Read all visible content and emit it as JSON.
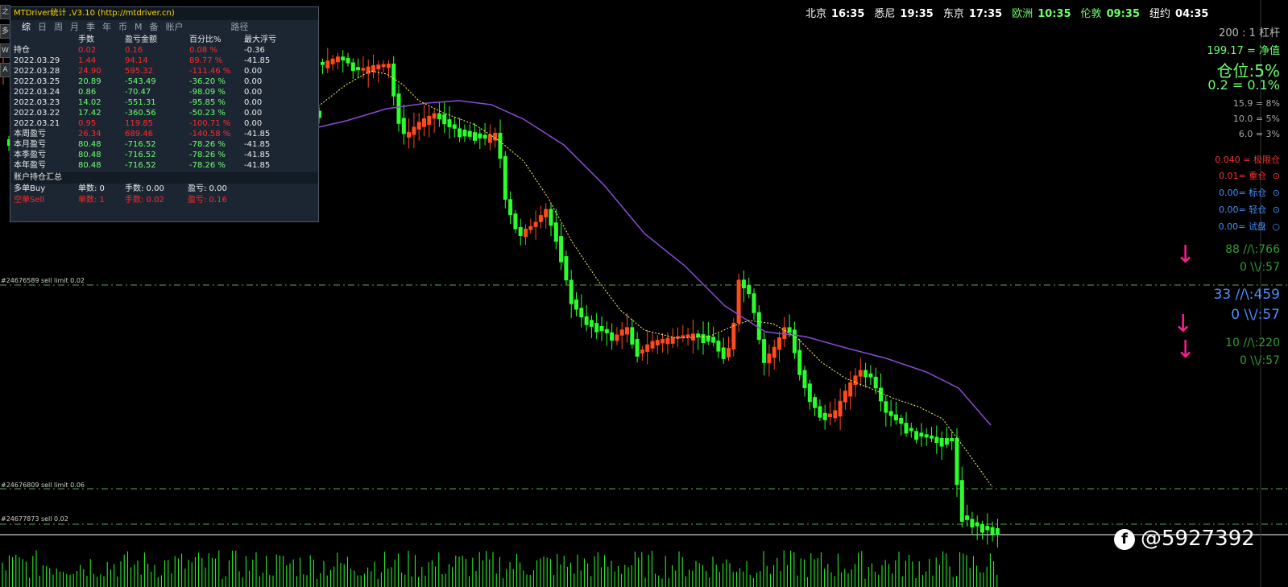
{
  "clocks": [
    {
      "city": "北京",
      "time": "16:35",
      "color": "#ffffff"
    },
    {
      "city": "悉尼",
      "time": "19:35",
      "color": "#ffffff"
    },
    {
      "city": "东京",
      "time": "17:35",
      "color": "#ffffff"
    },
    {
      "city": "欧洲",
      "time": "10:35",
      "color": "#6cff6c"
    },
    {
      "city": "伦敦",
      "time": "09:35",
      "color": "#6cff6c"
    },
    {
      "city": "纽约",
      "time": "04:35",
      "color": "#ffffff"
    }
  ],
  "panel": {
    "title": "MTDriver统计 ,V3.10 (http://mtdriver.cn)",
    "tabs": [
      "综",
      "日",
      "周",
      "月",
      "季",
      "年",
      "币",
      "M",
      "备",
      "账户",
      "路径"
    ],
    "columns": [
      "",
      "手数",
      "盈亏金额",
      "百分比%",
      "最大浮亏"
    ],
    "rows": [
      {
        "label": "持仓",
        "lots": "0.02",
        "pnl": "0.16",
        "pct": "0.08 %",
        "maxdd": "-0.36",
        "color": "red"
      },
      {
        "label": "2022.03.29",
        "lots": "1.44",
        "pnl": "94.14",
        "pct": "89.77 %",
        "maxdd": "-41.85",
        "color": "red"
      },
      {
        "label": "2022.03.28",
        "lots": "24.90",
        "pnl": "595.32",
        "pct": "-111.46 %",
        "maxdd": "0.00",
        "color": "red"
      },
      {
        "label": "2022.03.25",
        "lots": "20.89",
        "pnl": "-543.49",
        "pct": "-36.20 %",
        "maxdd": "0.00",
        "color": "green"
      },
      {
        "label": "2022.03.24",
        "lots": "0.86",
        "pnl": "-70.47",
        "pct": "-98.09 %",
        "maxdd": "0.00",
        "color": "green"
      },
      {
        "label": "2022.03.23",
        "lots": "14.02",
        "pnl": "-551.31",
        "pct": "-95.85 %",
        "maxdd": "0.00",
        "color": "green"
      },
      {
        "label": "2022.03.22",
        "lots": "17.42",
        "pnl": "-360.56",
        "pct": "-50.23 %",
        "maxdd": "0.00",
        "color": "green"
      },
      {
        "label": "2022.03.21",
        "lots": "0.95",
        "pnl": "119.85",
        "pct": "-100.71 %",
        "maxdd": "0.00",
        "color": "red"
      },
      {
        "label": "本周盈亏",
        "lots": "26.34",
        "pnl": "689.46",
        "pct": "-140.58 %",
        "maxdd": "-41.85",
        "color": "red"
      },
      {
        "label": "本月盈亏",
        "lots": "80.48",
        "pnl": "-716.52",
        "pct": "-78.26 %",
        "maxdd": "-41.85",
        "color": "green"
      },
      {
        "label": "本季盈亏",
        "lots": "80.48",
        "pnl": "-716.52",
        "pct": "-78.26 %",
        "maxdd": "-41.85",
        "color": "green"
      },
      {
        "label": "本年盈亏",
        "lots": "80.48",
        "pnl": "-716.52",
        "pct": "-78.26 %",
        "maxdd": "-41.85",
        "color": "green"
      }
    ],
    "summary_title": "账户持仓汇总",
    "summary": [
      {
        "label": "多单Buy",
        "count": "单数: 0",
        "lots": "手数: 0.00",
        "pnl": "盈亏: 0.00",
        "color": "white"
      },
      {
        "label": "空单Sell",
        "count": "单数: 1",
        "lots": "手数: 0.02",
        "pnl": "盈亏: 0.16",
        "color": "red"
      }
    ]
  },
  "left_stubs": [
    "之",
    "多",
    "W",
    "A"
  ],
  "right_panel": {
    "leverage": "200 : 1  杠杆",
    "equity": "199.17 = 净值",
    "position": "仓位:5%",
    "position_detail": "0.2 = 0.1%",
    "levels": [
      "15.9 = 8%",
      "10.0 = 5%",
      "6.0 = 3%"
    ],
    "limit": "0.040 = 极限仓",
    "lot_sizes": [
      {
        "text": "0.01= 重仓",
        "color": "#ff3030",
        "icon": "circle-dot-icon"
      },
      {
        "text": "0.00= 标仓",
        "color": "#4a90ff",
        "icon": "circle-dot-icon"
      },
      {
        "text": "0.00= 轻仓",
        "color": "#4a90ff",
        "icon": "circle-dot-icon"
      },
      {
        "text": "0.00= 试盘",
        "color": "#4a90ff",
        "icon": "circle-icon"
      }
    ],
    "signals": [
      {
        "up": "88 //\\:766",
        "down": "0 \\\\/:57",
        "color": "#2e9e2e"
      },
      {
        "up": "33 //\\:459",
        "down": "0 \\\\/:57",
        "color": "#4a90ff"
      },
      {
        "up": "10 //\\:220",
        "down": "0 \\\\/:57",
        "color": "#2e9e2e"
      }
    ]
  },
  "order_labels": [
    "#24676589 sell limit 0.02",
    "#24676809 sell limit 0.06",
    "#24677873 sell 0.02"
  ],
  "watermark": "@5927392",
  "colors": {
    "bull": "#ff4a1c",
    "bear": "#2bff2b",
    "ma_slow": "#8a4bd8",
    "ma_fast": "#ffff66",
    "order_line": "#55aa55"
  }
}
